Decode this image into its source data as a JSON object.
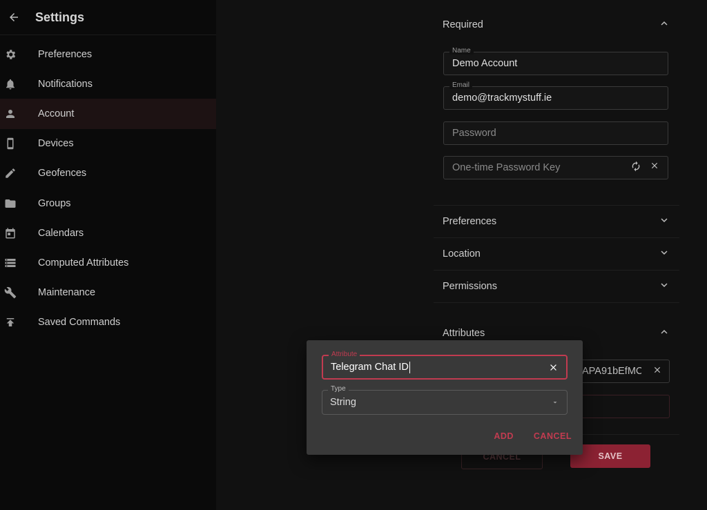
{
  "sidebar": {
    "title": "Settings",
    "items": [
      {
        "label": "Preferences",
        "icon": "gear-icon"
      },
      {
        "label": "Notifications",
        "icon": "bell-icon"
      },
      {
        "label": "Account",
        "icon": "person-icon",
        "active": true
      },
      {
        "label": "Devices",
        "icon": "phone-icon"
      },
      {
        "label": "Geofences",
        "icon": "pencil-icon"
      },
      {
        "label": "Groups",
        "icon": "folder-icon"
      },
      {
        "label": "Calendars",
        "icon": "calendar-icon"
      },
      {
        "label": "Computed Attributes",
        "icon": "storage-icon"
      },
      {
        "label": "Maintenance",
        "icon": "wrench-icon"
      },
      {
        "label": "Saved Commands",
        "icon": "publish-icon"
      }
    ]
  },
  "form": {
    "required_title": "Required",
    "name_label": "Name",
    "name_value": "Demo Account",
    "email_label": "Email",
    "email_value": "demo@trackmystuff.ie",
    "password_placeholder": "Password",
    "otp_placeholder": "One-time Password Key",
    "sections": [
      "Preferences",
      "Location",
      "Permissions"
    ],
    "attributes_title": "Attributes",
    "attribute_partial_value": "APA91bEfMC",
    "cancel_label": "CANCEL",
    "save_label": "SAVE"
  },
  "dialog": {
    "attribute_label": "Attribute",
    "attribute_value": "Telegram Chat ID",
    "type_label": "Type",
    "type_value": "String",
    "add_label": "ADD",
    "cancel_label": "CANCEL"
  },
  "colors": {
    "accent": "#c23b50",
    "save_button": "#8c2233"
  }
}
